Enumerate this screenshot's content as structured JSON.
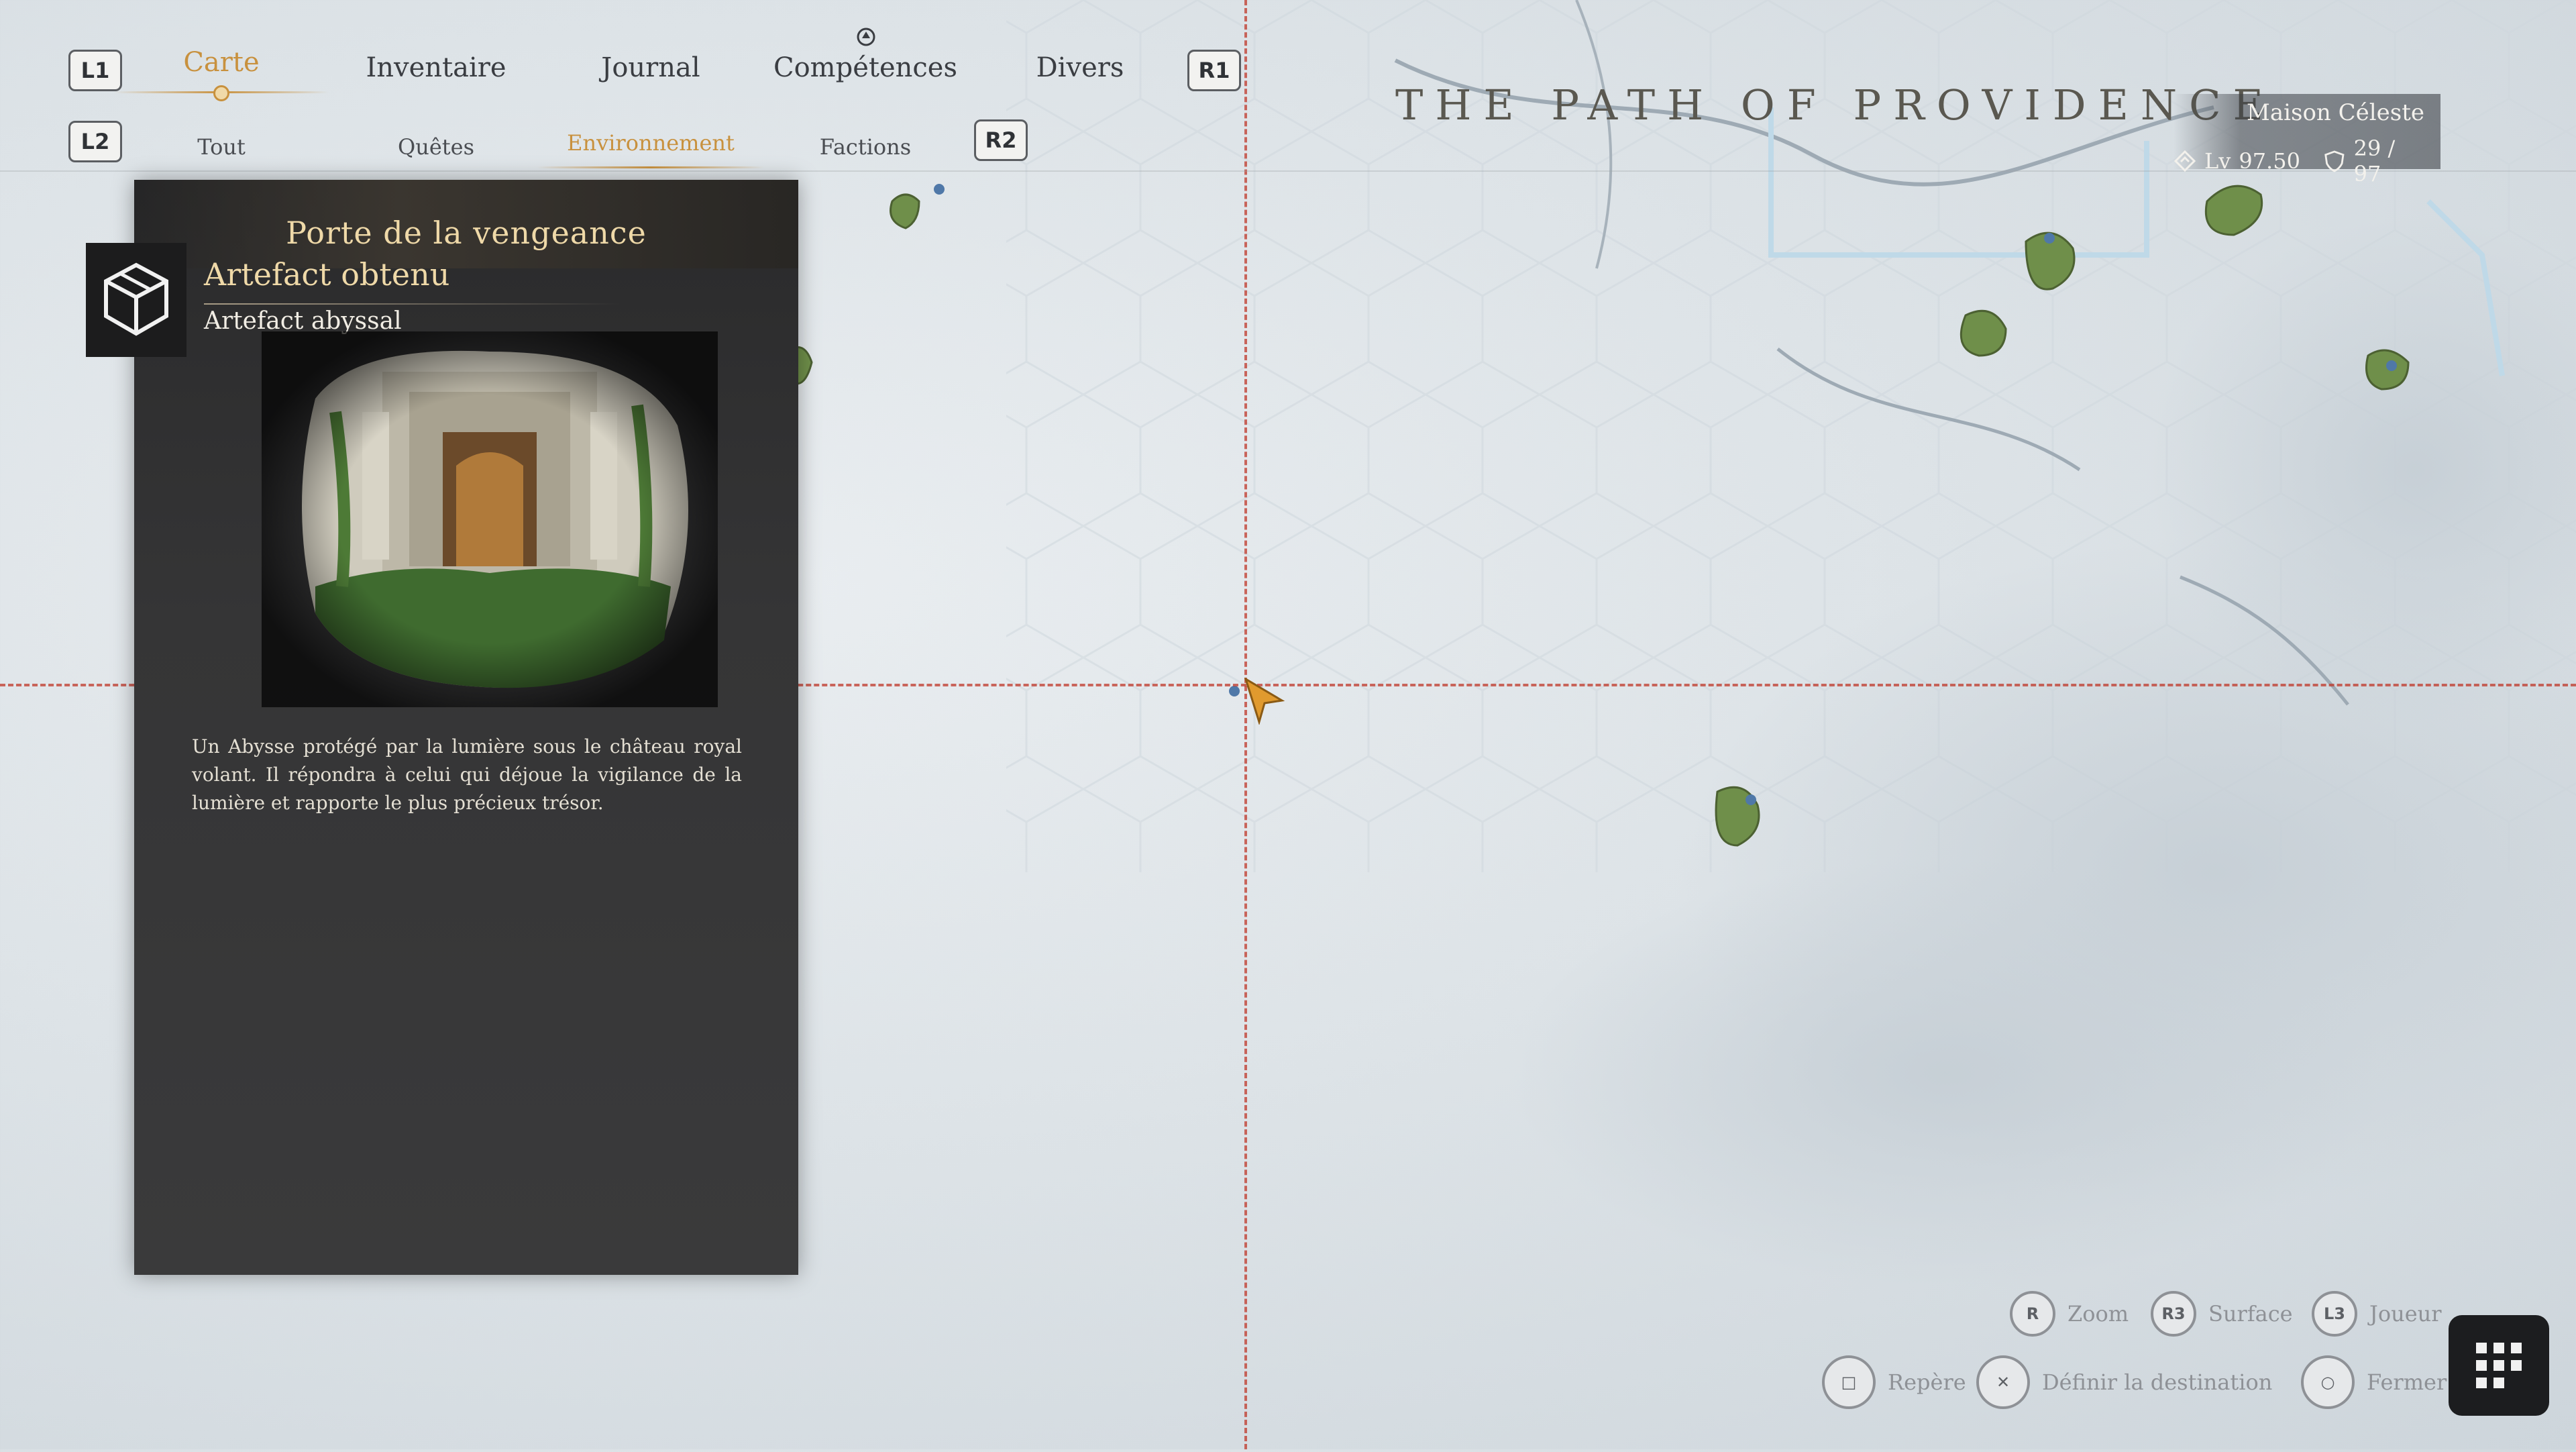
{
  "nav": {
    "l1": "L1",
    "r1": "R1",
    "l2": "L2",
    "r2": "R2",
    "tabs": [
      {
        "label": "Carte",
        "active": true
      },
      {
        "label": "Inventaire",
        "active": false
      },
      {
        "label": "Journal",
        "active": false
      },
      {
        "label": "Compétences",
        "active": false
      },
      {
        "label": "Divers",
        "active": false
      }
    ],
    "subtabs": [
      {
        "label": "Tout",
        "active": false
      },
      {
        "label": "Quêtes",
        "active": false
      },
      {
        "label": "Environnement",
        "active": true
      },
      {
        "label": "Factions",
        "active": false
      }
    ]
  },
  "panel": {
    "title": "Porte de la vengeance",
    "status": "Artefact obtenu",
    "subtitle": "Artefact abyssal",
    "description": "Un Abysse protégé par la lumière sous le château royal volant. Il répondra à celui qui déjoue la vigilance de la lumière et rapporte le plus précieux trésor."
  },
  "region": {
    "title": "THE PATH OF PROVIDENCE",
    "location": "Maison Céleste",
    "level_label": "Lv",
    "level": "97.50",
    "collectibles": "29  /  97"
  },
  "hints": [
    {
      "button": "R",
      "label": "Zoom"
    },
    {
      "button": "R3",
      "label": "Surface"
    },
    {
      "button": "L3",
      "label": "Joueur"
    },
    {
      "button": "□",
      "label": "Repère"
    },
    {
      "button": "✕",
      "label": "Définir la destination"
    },
    {
      "button": "○",
      "label": "Fermer"
    }
  ],
  "colors": {
    "accent": "#c8913e",
    "crosshair": "#c0392b",
    "panel_bg": "#353536"
  }
}
